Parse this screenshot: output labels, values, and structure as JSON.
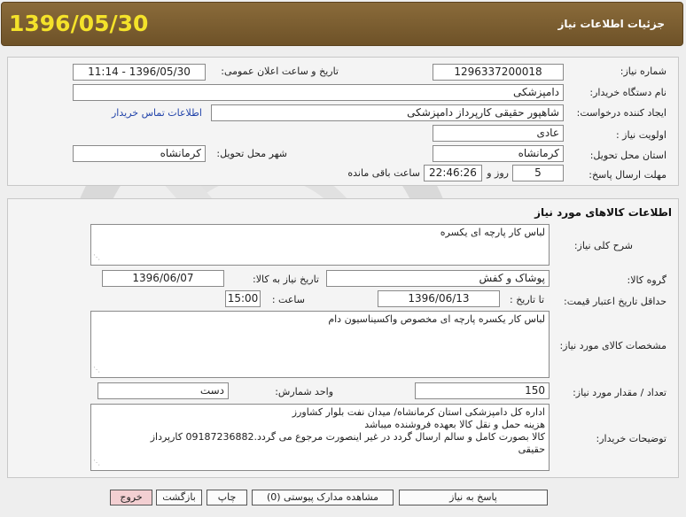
{
  "header": {
    "date": "1396/05/30",
    "title": "جزئیات اطلاعات نیاز"
  },
  "need_info": {
    "need_number_label": "شماره نیاز:",
    "need_number": "1296337200018",
    "announce_label": "تاریخ و ساعت اعلان عمومی:",
    "announce_value": "1396/05/30 - 11:14",
    "buyer_org_label": "نام دستگاه خریدار:",
    "buyer_org": "دامپزشکی",
    "creator_label": "ایجاد کننده درخواست:",
    "creator": "شاهپور حقیقی کارپرداز دامپزشکی",
    "contact_link": "اطلاعات تماس خریدار",
    "priority_label": "اولویت نیاز :",
    "priority": "عادی",
    "province_label": "استان محل تحویل:",
    "province": "کرمانشاه",
    "city_label": "شهر محل تحویل:",
    "city": "کرمانشاه",
    "deadline_label": "مهلت ارسال پاسخ:",
    "deadline_days": "5",
    "days_and_label": "روز و",
    "deadline_time": "22:46:26",
    "remaining_label": "ساعت باقی مانده"
  },
  "goods": {
    "section_title": "اطلاعات کالاهای مورد نیاز",
    "summary_label": "شرح کلی نیاز:",
    "summary": "لباس کار پارچه ای یکسره",
    "group_label": "گروه کالا:",
    "group": "پوشاک و کفش",
    "need_date_label": "تاریخ نیاز به کالا:",
    "need_date": "1396/06/07",
    "min_validity_label": "حداقل تاریخ اعتبار قیمت:",
    "until_date_label": "تا تاریخ :",
    "until_date": "1396/06/13",
    "time_label": "ساعت :",
    "time": "15:00",
    "specs_label": "مشخصات کالای مورد نیاز:",
    "specs": "لباس کار یکسره پارچه ای مخصوص واکسیناسیون دام",
    "quantity_label": "تعداد / مقدار مورد نیاز:",
    "quantity": "150",
    "unit_label": "واحد شمارش:",
    "unit": "دست",
    "buyer_notes_label": "توضیحات خریدار:",
    "buyer_notes": [
      "اداره کل دامپزشکی استان کرمانشاه/ میدان نفت بلوار کشاورز",
      "هزینه حمل و نقل کالا بعهده فروشنده میباشد",
      "کالا بصورت کامل و سالم ارسال گردد در غیر اینصورت مرجوع می گردد.09187236882 کارپرداز",
      "حقیقی"
    ]
  },
  "buttons": {
    "reply": "پاسخ به نیاز",
    "attachments": "مشاهده مدارک پیوستی (0)",
    "print": "چاپ",
    "back": "بازگشت",
    "exit": "خروج"
  },
  "colors": {
    "header_bg": "#7a5c2e",
    "header_date": "#f4e22a",
    "exit_button": "#f3cfd2",
    "link": "#2244aa"
  }
}
